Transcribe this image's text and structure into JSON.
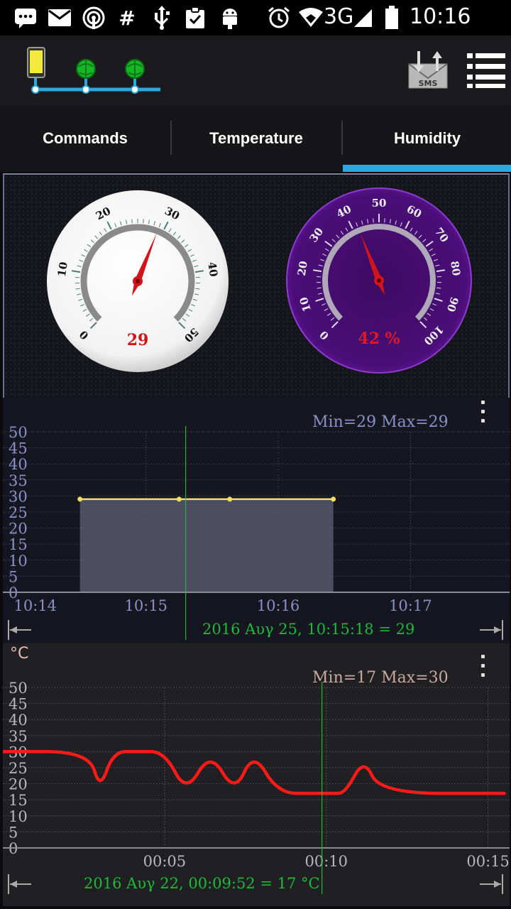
{
  "status_bar": {
    "network": "3G",
    "time": "10:16 π.μ."
  },
  "tabs": [
    {
      "label": "Commands",
      "selected": false
    },
    {
      "label": "Temperature",
      "selected": false
    },
    {
      "label": "Humidity",
      "selected": true
    }
  ],
  "colors": {
    "accent": "#2aa8e0",
    "needle": "#d0141a",
    "humidity_gauge": "#4a0e75",
    "temp_line_1": "#f2e060",
    "temp_line_2": "#ff1a1a",
    "cursor": "#1cba3a"
  },
  "icons": {
    "logo": "phone-network-icon",
    "sms": "sms-envelope-icon",
    "menu": "hamburger-menu-icon"
  },
  "gauges": {
    "temperature": {
      "value": 29,
      "readout": "29",
      "ticks": [
        "0",
        "10",
        "20",
        "30",
        "40",
        "50"
      ]
    },
    "humidity": {
      "value": 42,
      "readout": "42 %",
      "ticks": [
        "0",
        "10",
        "20",
        "30",
        "40",
        "50",
        "60",
        "70",
        "80",
        "90",
        "100"
      ]
    }
  },
  "chart_data": [
    {
      "type": "area",
      "minmax": "Min=29  Max=29",
      "ylim": [
        0,
        50
      ],
      "yticks": [
        "50",
        "45",
        "40",
        "35",
        "30",
        "25",
        "20",
        "15",
        "10",
        "5",
        "0"
      ],
      "xticks": [
        "10:14",
        "10:15",
        "10:16",
        "10:17"
      ],
      "series": [
        {
          "x": [
            "10:14:30",
            "10:15:15",
            "10:15:38",
            "10:16:25"
          ],
          "values": [
            29,
            29,
            29,
            29
          ]
        }
      ],
      "cursor_readout": "2016 Αυγ 25, 10:15:18 = 29",
      "cursor_x": "10:15:18",
      "unit": ""
    },
    {
      "type": "line",
      "minmax": "Min=17  Max=30",
      "unit": "°C",
      "ylim": [
        0,
        50
      ],
      "yticks": [
        "50",
        "45",
        "40",
        "35",
        "30",
        "25",
        "20",
        "15",
        "10",
        "5",
        "0"
      ],
      "xticks": [
        "00:05",
        "00:10",
        "00:15"
      ],
      "series": [
        {
          "x": [
            "00:00",
            "00:02:40",
            "00:03:00",
            "00:03:25",
            "00:04:10",
            "00:05:00",
            "00:05:40",
            "00:06:25",
            "00:07:10",
            "00:07:45",
            "00:08:30",
            "00:09:40",
            "00:10:10",
            "00:10:35",
            "00:11:10",
            "00:11:40",
            "00:15:30"
          ],
          "values": [
            30,
            30,
            18,
            30,
            30,
            30,
            17,
            30,
            17,
            30,
            17,
            17,
            17,
            17,
            28,
            17,
            17
          ]
        }
      ],
      "cursor_readout": "2016 Αυγ 22, 00:09:52 = 17 °C",
      "cursor_x": "00:09:52"
    }
  ]
}
